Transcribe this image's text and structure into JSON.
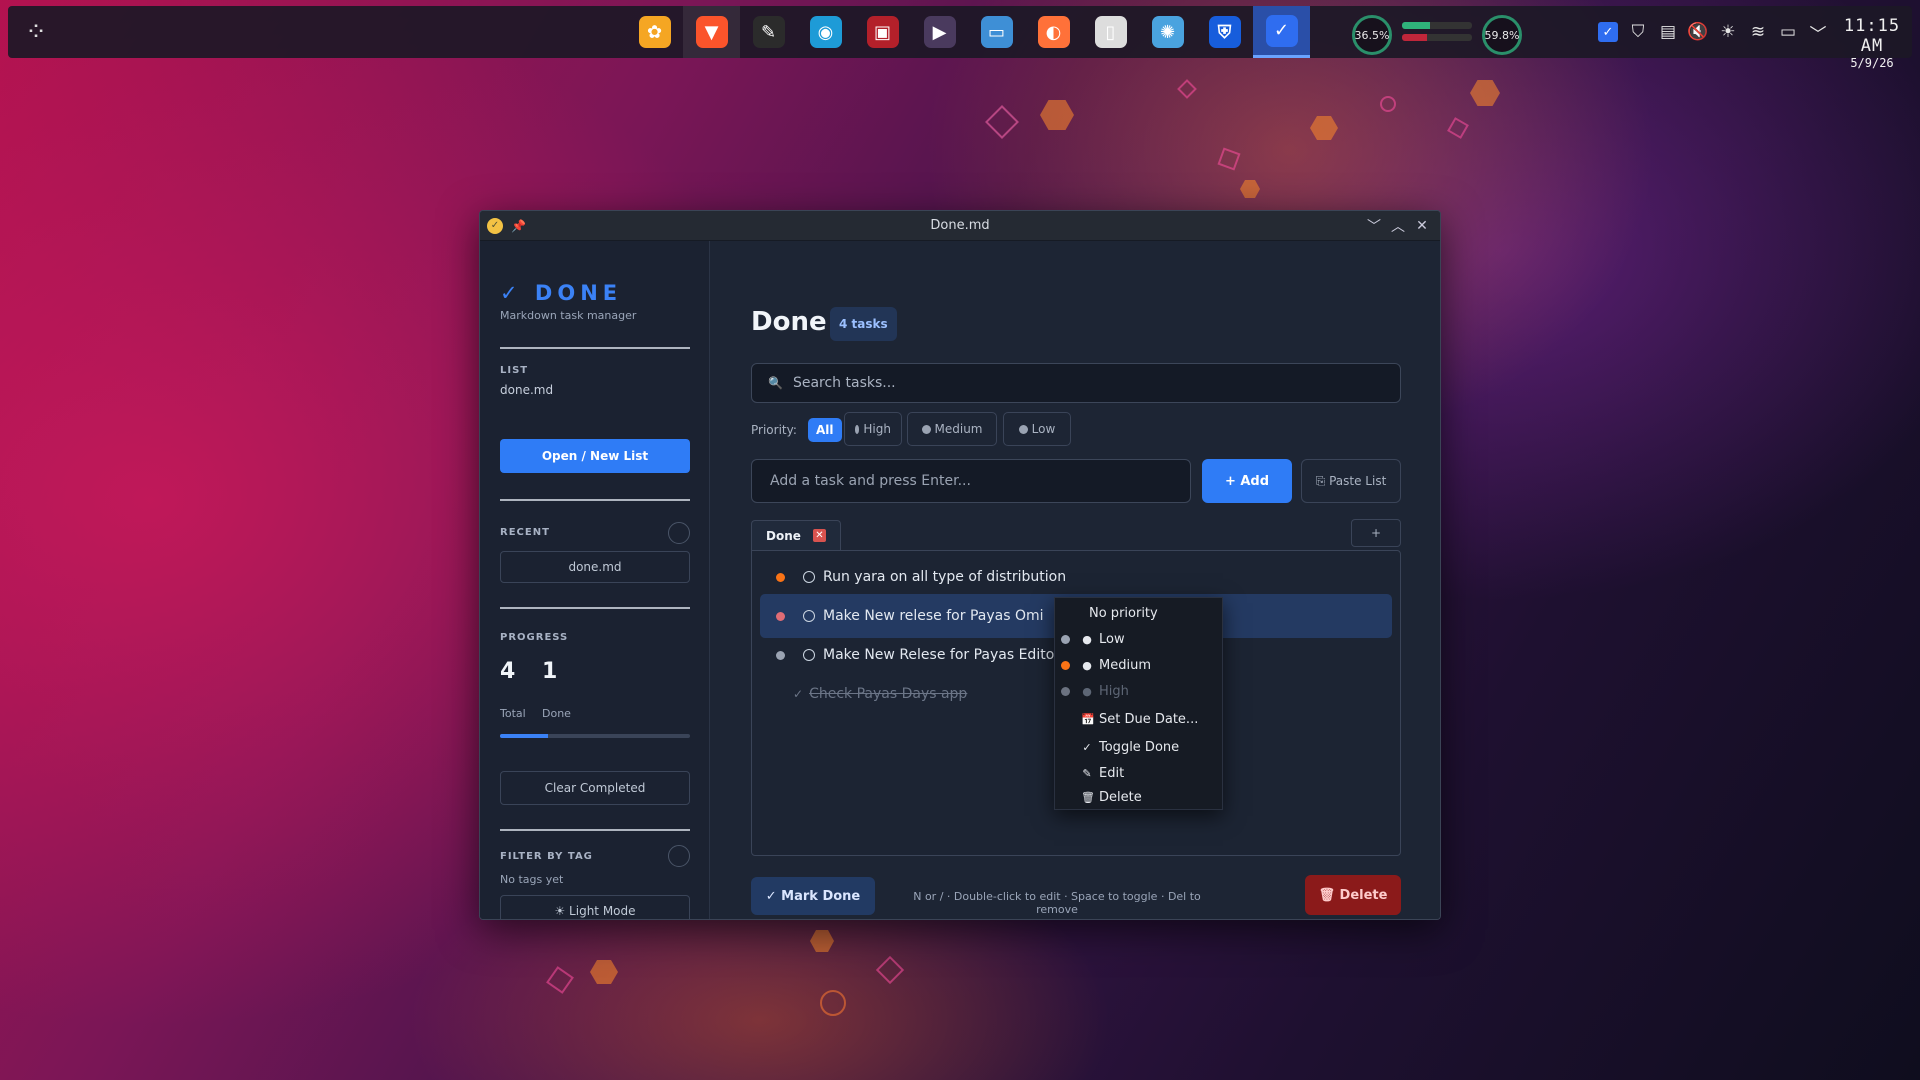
{
  "colors": {
    "accent": "#2f7cf6",
    "priority_medium": "#f97316",
    "priority_high": "#e06c75",
    "priority_none": "#9aa3b2",
    "danger": "#8b1a1a"
  },
  "taskbar": {
    "launcher_icon": "launcher-dots-icon",
    "apps": [
      {
        "name": "pets-app",
        "icon": "paw-icon",
        "glyph": "✿",
        "color": "#f5a623"
      },
      {
        "name": "brave-browser",
        "icon": "lion-shield-icon",
        "glyph": "▼",
        "color": "#fb542b"
      },
      {
        "name": "text-editor",
        "icon": "pen-paper-icon",
        "glyph": "✎",
        "color": "#2b2b2b"
      },
      {
        "name": "compass-app",
        "icon": "compass-icon",
        "glyph": "◉",
        "color": "#1e9bd7"
      },
      {
        "name": "terminal-app",
        "icon": "terminal-icon",
        "glyph": "▣",
        "color": "#b3202a"
      },
      {
        "name": "media-player",
        "icon": "play-disc-icon",
        "glyph": "▶",
        "color": "#4a3a5e"
      },
      {
        "name": "file-manager",
        "icon": "folder-icon",
        "glyph": "▭",
        "color": "#3e8fd6"
      },
      {
        "name": "firefox-browser",
        "icon": "firefox-icon",
        "glyph": "◐",
        "color": "#ff7139"
      },
      {
        "name": "document-viewer",
        "icon": "document-icon",
        "glyph": "▯",
        "color": "#dddddd"
      },
      {
        "name": "settings-app",
        "icon": "gear-icon",
        "glyph": "✺",
        "color": "#4aa3df"
      },
      {
        "name": "bitwarden",
        "icon": "shield-icon",
        "glyph": "⛨",
        "color": "#175ddc"
      },
      {
        "name": "done-app",
        "icon": "checkmark-icon",
        "glyph": "✓",
        "color": "#2f6df0"
      }
    ],
    "gauge_left": "36.5%",
    "gauge_right": "59.8%",
    "tray_icons": [
      "checkbox-icon",
      "shield-check-icon",
      "clipboard-icon",
      "speaker-muted-icon",
      "brightness-icon",
      "wifi-icon",
      "battery-icon",
      "chevron-down-icon"
    ],
    "time": "11:15 AM",
    "date": "5/9/26"
  },
  "window": {
    "title": "Done.md",
    "controls": [
      "minimize-icon",
      "maximize-icon",
      "close-icon"
    ]
  },
  "sidebar": {
    "brand_check": "✓",
    "brand": "DONE",
    "brand_sub": "Markdown task manager",
    "list_label": "LIST",
    "list_name": "done.md",
    "open_button": "Open / New List",
    "recent_label": "RECENT",
    "recent_item": "done.md",
    "progress_label": "PROGRESS",
    "total": "4",
    "done": "1",
    "total_label": "Total",
    "done_label": "Done",
    "progress_fraction": 0.25,
    "clear_button": "Clear Completed",
    "filter_label": "FILTER BY TAG",
    "no_tags": "No tags yet",
    "light_mode": "☀ Light Mode"
  },
  "main": {
    "title": "Done",
    "count_badge": "4 tasks",
    "search_icon": "🔍",
    "search_placeholder": "Search tasks...",
    "priority_label": "Priority:",
    "priority_filters": [
      {
        "label": "All",
        "active": true
      },
      {
        "label": "High",
        "active": false
      },
      {
        "label": "Medium",
        "active": false
      },
      {
        "label": "Low",
        "active": false
      }
    ],
    "add_placeholder": "Add a task and press Enter...",
    "add_button": "+ Add",
    "paste_button": "⎘ Paste List",
    "tab_label": "Done",
    "tab_close": "✕",
    "tab_add": "+",
    "tasks": [
      {
        "text": "Run yara on all type of distribution",
        "priority": "medium",
        "done": false,
        "selected": false
      },
      {
        "text": "Make New relese for Payas Omi",
        "priority": "high",
        "done": false,
        "selected": true
      },
      {
        "text": "Make New Relese for Payas Editor",
        "priority": "none",
        "done": false,
        "selected": false
      },
      {
        "text": "Check Payas Days app",
        "priority": "none",
        "done": true,
        "selected": false
      }
    ],
    "done_check": "✓",
    "mark_done": "✓  Mark Done",
    "hint": "N or / · Double-click to edit · Space to toggle · Del to remove",
    "delete_button": "🗑  Delete"
  },
  "context_menu": {
    "no_priority": "No priority",
    "low": "Low",
    "medium": "Medium",
    "high": "High",
    "due_date": "Set Due Date...",
    "toggle_done": "Toggle Done",
    "edit": "Edit",
    "delete": "Delete",
    "glyphs": {
      "bullet": "●",
      "calendar": "📅",
      "check": "✓",
      "pencil": "✎",
      "trash": "🗑"
    }
  }
}
